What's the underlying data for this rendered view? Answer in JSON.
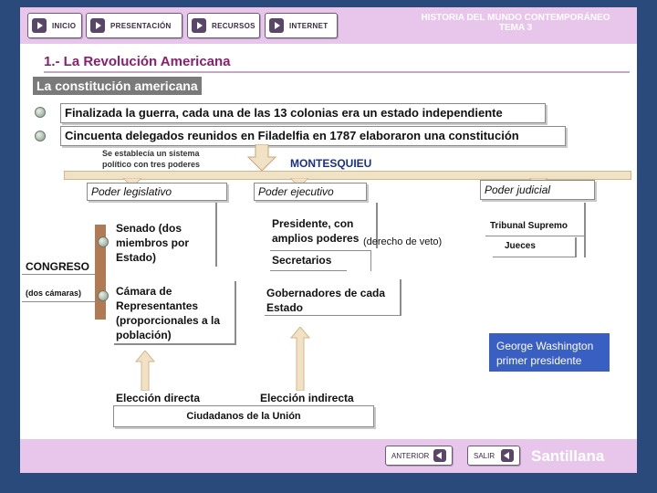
{
  "nav": {
    "items": [
      "INICIO",
      "PRESENTACIÓN",
      "RECURSOS",
      "INTERNET"
    ]
  },
  "header": {
    "title_line1": "HISTORIA DEL MUNDO CONTEMPORÁNEO",
    "title_line2": "TEMA 3"
  },
  "section": {
    "title": "1.- La Revolución Americana",
    "subtitle": "La constitución americana"
  },
  "bullets": [
    "Finalizada la guerra, cada una de las 13 colonias era un estado independiente",
    "Cincuenta delegados reunidos en Filadelfia en 1787 elaboraron una constitución"
  ],
  "diagram": {
    "system_note": "Se establecía un sistema político con tres poderes",
    "montesquieu": "MONTESQUIEU",
    "powers": {
      "legislative": "Poder legislativo",
      "executive": "Poder ejecutivo",
      "judicial": "Poder judicial"
    },
    "senado": "Senado (dos miembros por Estado)",
    "camara": "Cámara de Representantes (proporcionales a la población)",
    "congreso": "CONGRESO",
    "dos_camaras": "(dos cámaras)",
    "presidente": "Presidente, con amplios poderes",
    "veto": "(derecho de veto)",
    "secretarios": "Secretarios",
    "gobernadores": "Gobernadores de cada Estado",
    "tribunal": "Tribunal Supremo",
    "jueces": "Jueces",
    "eleccion_directa": "Elección directa",
    "eleccion_indirecta": "Elección indirecta",
    "ciudadanos": "Ciudadanos de la Unión",
    "washington": "George Washington primer presidente"
  },
  "footer": {
    "anterior": "ANTERIOR",
    "salir": "SALIR",
    "brand": "Santillana"
  }
}
